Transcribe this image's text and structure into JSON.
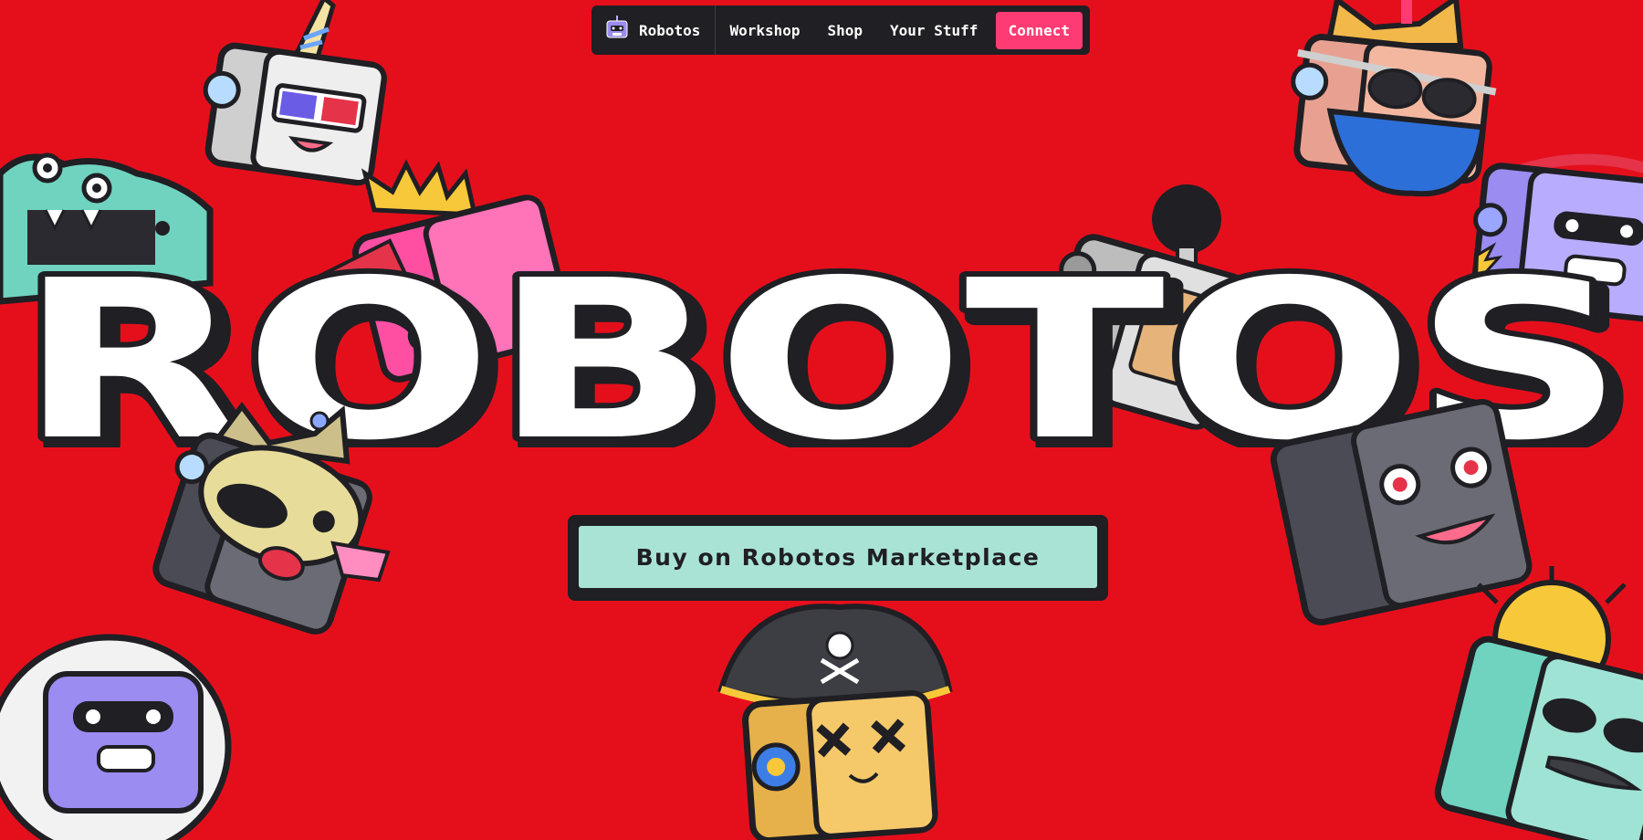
{
  "nav": {
    "brand_label": "Robotos",
    "links": [
      "Workshop",
      "Shop",
      "Your Stuff"
    ],
    "connect_label": "Connect"
  },
  "hero": {
    "title": "ROBOTOS"
  },
  "cta": {
    "label": "Buy on Robotos Marketplace"
  },
  "colors": {
    "background": "#e50f1c",
    "nav_background": "#1f1f24",
    "connect": "#ff3b73",
    "cta": "#a9e3d6",
    "outline": "#1f1f24"
  },
  "decorations": [
    "unicorn-robot",
    "crocodile-robot",
    "king-robot",
    "cat-robot",
    "purple-robot",
    "antenna-robot",
    "shiba-robot",
    "grey-robot",
    "astronaut-robot",
    "pirate-robot",
    "sun-robot"
  ]
}
